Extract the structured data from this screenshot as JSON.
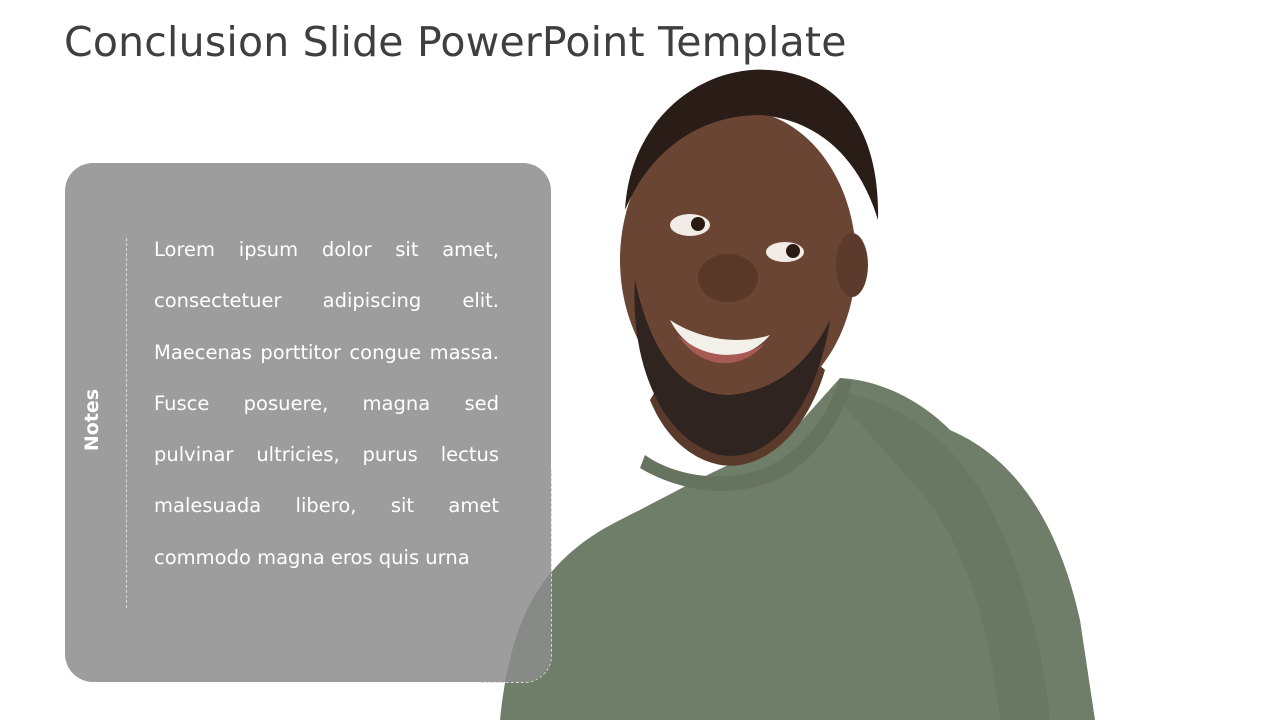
{
  "slide": {
    "title": "Conclusion Slide PowerPoint Template",
    "notes_label": "Notes",
    "notes_text": "Lorem ipsum dolor sit amet, consectetuer adipiscing elit. Maecenas porttitor congue massa. Fusce posuere, magna sed pulvinar ultricies, purus lectus malesuada libero, sit amet commodo magna eros quis urna",
    "photo": {
      "description": "smiling bearded man in green t-shirt looking sideways",
      "shirt_color": "#6f7e69",
      "skin_color": "#6a4533"
    },
    "colors": {
      "panel": "#9a9a9a",
      "title": "#3f3f3f",
      "text": "#ffffff"
    }
  }
}
